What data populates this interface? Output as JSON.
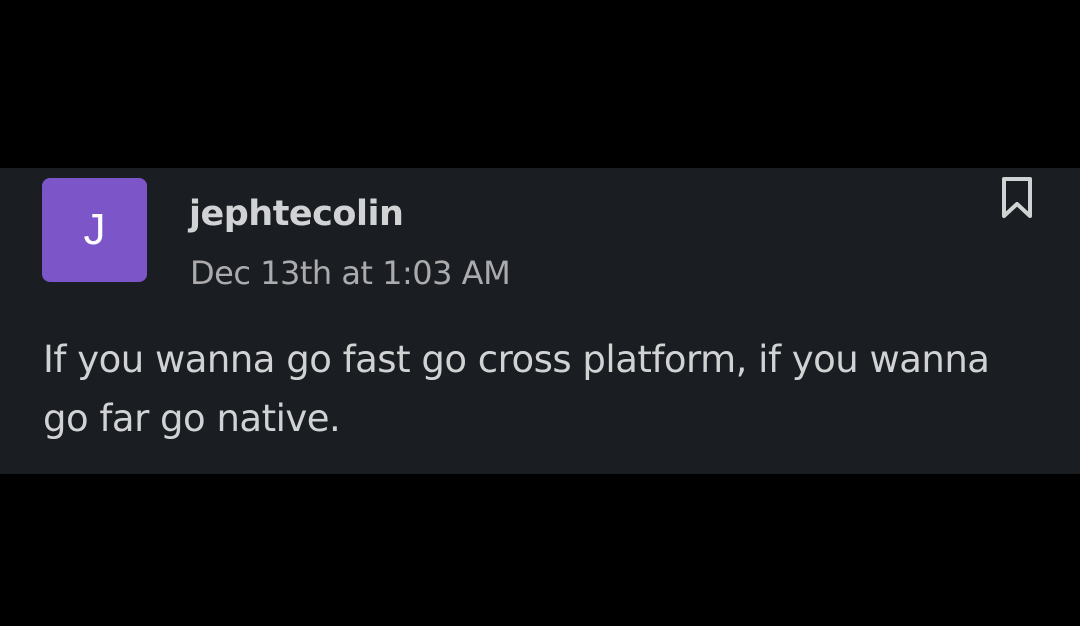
{
  "message": {
    "avatar_initial": "J",
    "author": "jephtecolin",
    "timestamp": "Dec 13th at 1:03 AM",
    "text": "If you wanna go fast go cross platform, if you wanna go far go native."
  },
  "icons": {
    "bookmark": "bookmark-icon"
  },
  "colors": {
    "page_background": "#000000",
    "message_background": "#1a1d21",
    "avatar_background": "#7c55c9",
    "text_primary": "#d1d2d3",
    "text_secondary": "#ababad"
  }
}
